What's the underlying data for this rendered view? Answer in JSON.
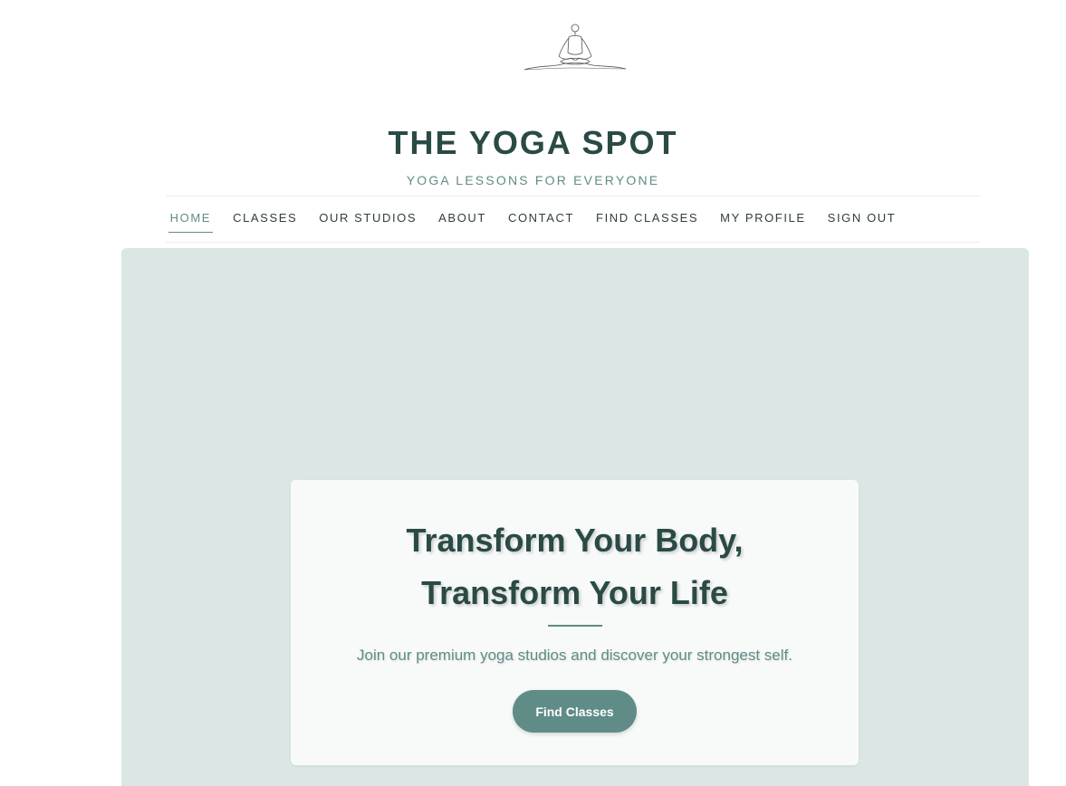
{
  "header": {
    "logo_icon": "meditation-figure-icon",
    "title": "THE YOGA SPOT",
    "tagline": "YOGA LESSONS FOR EVERYONE"
  },
  "nav": {
    "items": [
      {
        "label": "HOME",
        "active": true
      },
      {
        "label": "CLASSES",
        "active": false
      },
      {
        "label": "OUR STUDIOS",
        "active": false
      },
      {
        "label": "ABOUT",
        "active": false
      },
      {
        "label": "CONTACT",
        "active": false
      },
      {
        "label": "FIND CLASSES",
        "active": false
      },
      {
        "label": "MY PROFILE",
        "active": false
      },
      {
        "label": "SIGN OUT",
        "active": false
      }
    ]
  },
  "hero": {
    "heading_line1": "Transform Your Body,",
    "heading_line2": "Transform Your Life",
    "subtitle": "Join our premium yoga studios and discover your strongest self.",
    "cta_label": "Find Classes"
  },
  "colors": {
    "primary": "#2a4a45",
    "accent": "#5f8c86",
    "hero_bg": "#dbe7e4"
  }
}
